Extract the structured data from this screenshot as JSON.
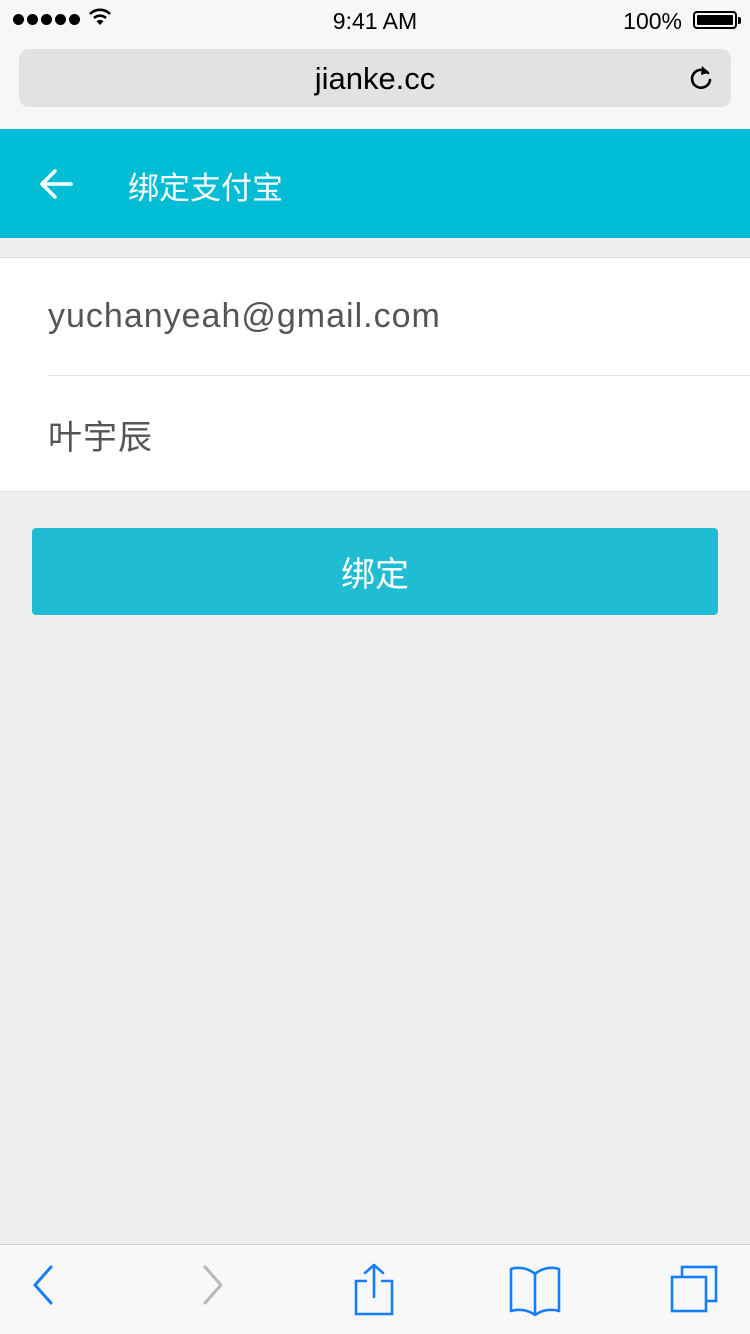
{
  "status_bar": {
    "time": "9:41 AM",
    "battery": "100%"
  },
  "browser": {
    "url": "jianke.cc"
  },
  "header": {
    "title": "绑定支付宝"
  },
  "form": {
    "account_value": "yuchanyeah@gmail.com",
    "name_value": "叶宇辰"
  },
  "actions": {
    "bind_label": "绑定"
  },
  "colors": {
    "accent": "#00bcd4",
    "button": "#1fbcd3",
    "ios_blue": "#157efb"
  },
  "icons": {
    "back": "arrow-left-icon",
    "reload": "reload-icon",
    "toolbar": [
      "back-chevron-icon",
      "forward-chevron-icon",
      "share-icon",
      "bookmarks-icon",
      "tabs-icon"
    ]
  }
}
